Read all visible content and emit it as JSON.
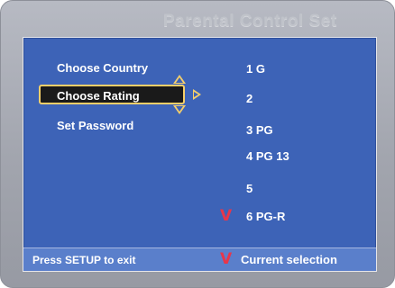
{
  "title": "Parental Control Set",
  "menu": [
    {
      "label": "Choose Country"
    },
    {
      "label": "Choose Rating",
      "selected": true
    },
    {
      "label": "Set Password"
    }
  ],
  "options": [
    "1 G",
    "2",
    "3 PG",
    "4 PG 13",
    "5",
    "6 PG-R"
  ],
  "current_option_index": 5,
  "check_mark": "V",
  "footer": {
    "hint": "Press SETUP to exit",
    "legend": "Current selection"
  },
  "colors": {
    "frame": "#a2a5ae",
    "panel": "#3d63b7",
    "footer": "#5a7fcb",
    "highlight": "#f6cf6a",
    "check": "#e8364a"
  },
  "icons": [
    "up-arrow-icon",
    "down-arrow-icon",
    "right-arrow-icon",
    "checkmark-icon"
  ]
}
